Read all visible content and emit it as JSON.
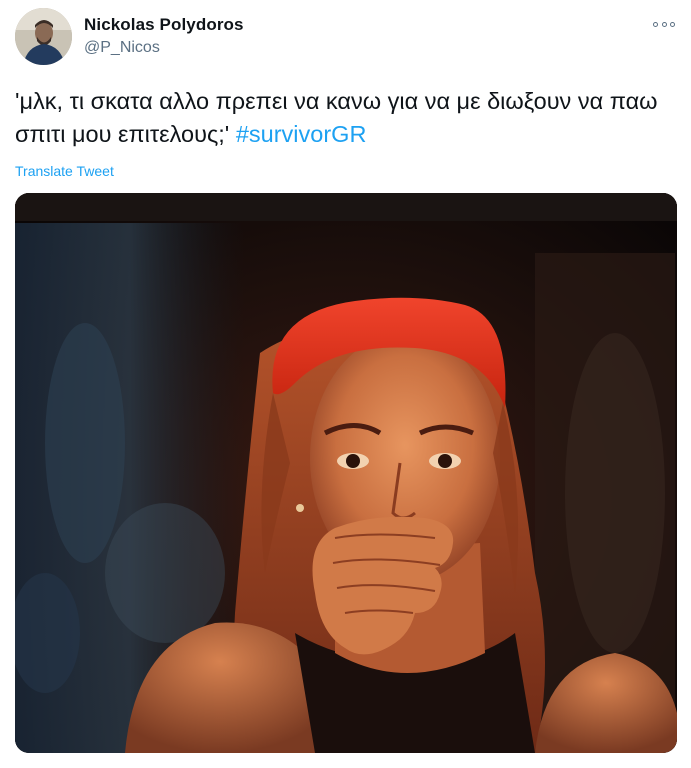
{
  "tweet": {
    "author_name": "Nickolas Polydoros",
    "author_handle": "@P_Nicos",
    "text_main": "'μλκ, τι σκατα αλλο πρεπει να κανω για να με διωξουν να παω σπιτι μου επιτελους;' ",
    "hashtag": "#survivorGR",
    "translate_label": "Translate Tweet",
    "more_icon": "more-options-icon",
    "avatar": "avatar",
    "media": "tv-screen-photo"
  },
  "colors": {
    "link": "#1da1f2",
    "secondary_text": "#5b7083",
    "primary_text": "#0f1419",
    "headband": "#e8301c"
  }
}
